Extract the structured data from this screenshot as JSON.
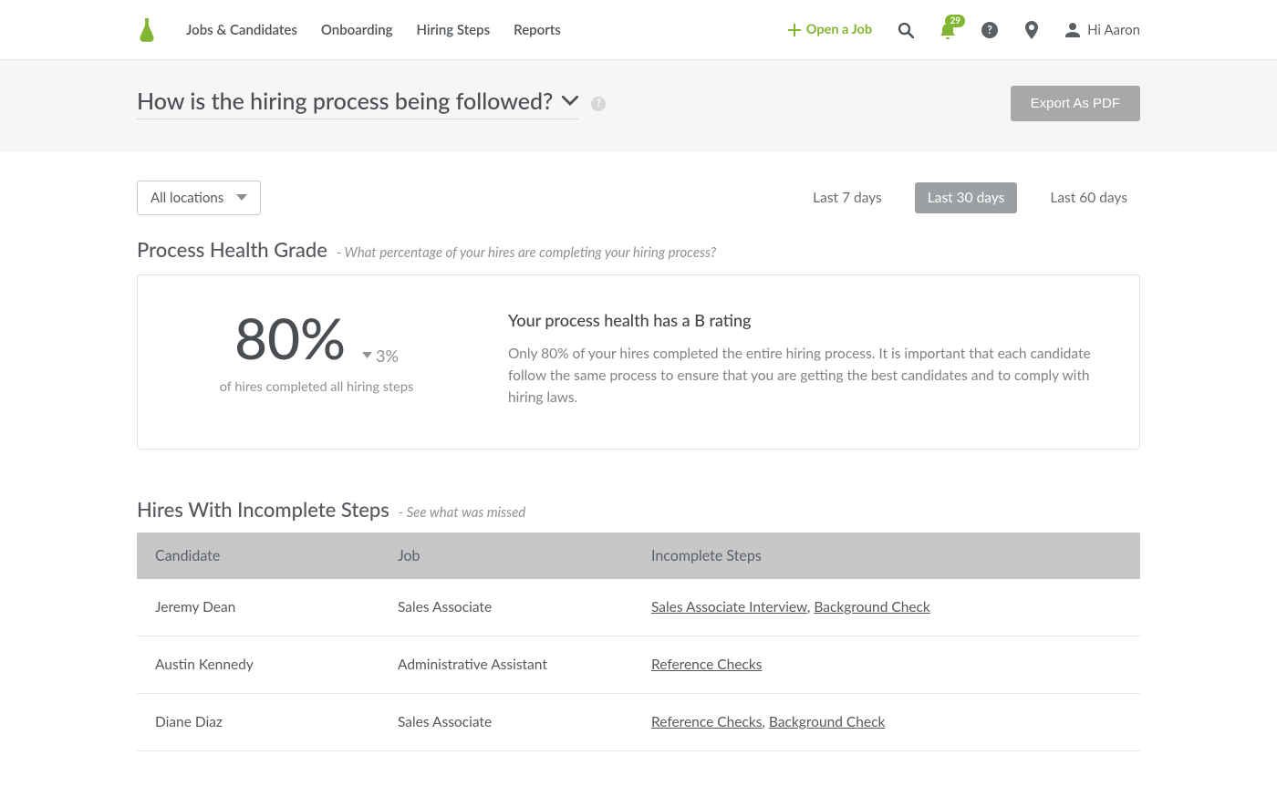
{
  "nav": {
    "items": [
      "Jobs & Candidates",
      "Onboarding",
      "Hiring Steps",
      "Reports"
    ],
    "open_job": "Open a Job",
    "notif_count": "29",
    "user_greeting": "Hi Aaron"
  },
  "header": {
    "title": "How is the hiring process being followed?",
    "export": "Export As PDF"
  },
  "filters": {
    "location": "All locations",
    "ranges": [
      "Last 7 days",
      "Last 30 days",
      "Last 60 days"
    ],
    "active_range": "Last 30 days"
  },
  "health": {
    "title": "Process Health Grade",
    "subtitle": "-   What percentage of your hires are completing your hiring process?",
    "pct": "80%",
    "delta": "3%",
    "pct_sub": "of hires completed all hiring steps",
    "rating_title": "Your process health has a B rating",
    "rating_body": "Only 80% of your hires completed the entire hiring process. It is important that each candidate follow the same process to ensure that you are getting the best candidates and to comply with hiring laws."
  },
  "incomplete": {
    "title": "Hires With Incomplete Steps",
    "subtitle": "-   See what was missed",
    "cols": [
      "Candidate",
      "Job",
      "Incomplete Steps"
    ],
    "rows": [
      {
        "candidate": "Jeremy Dean",
        "job": "Sales Associate",
        "steps": [
          "Sales Associate Interview",
          "Background Check"
        ]
      },
      {
        "candidate": "Austin Kennedy",
        "job": "Administrative Assistant",
        "steps": [
          "Reference Checks"
        ]
      },
      {
        "candidate": "Diane Diaz",
        "job": "Sales Associate",
        "steps": [
          "Reference Checks",
          "Background Check"
        ]
      }
    ]
  }
}
